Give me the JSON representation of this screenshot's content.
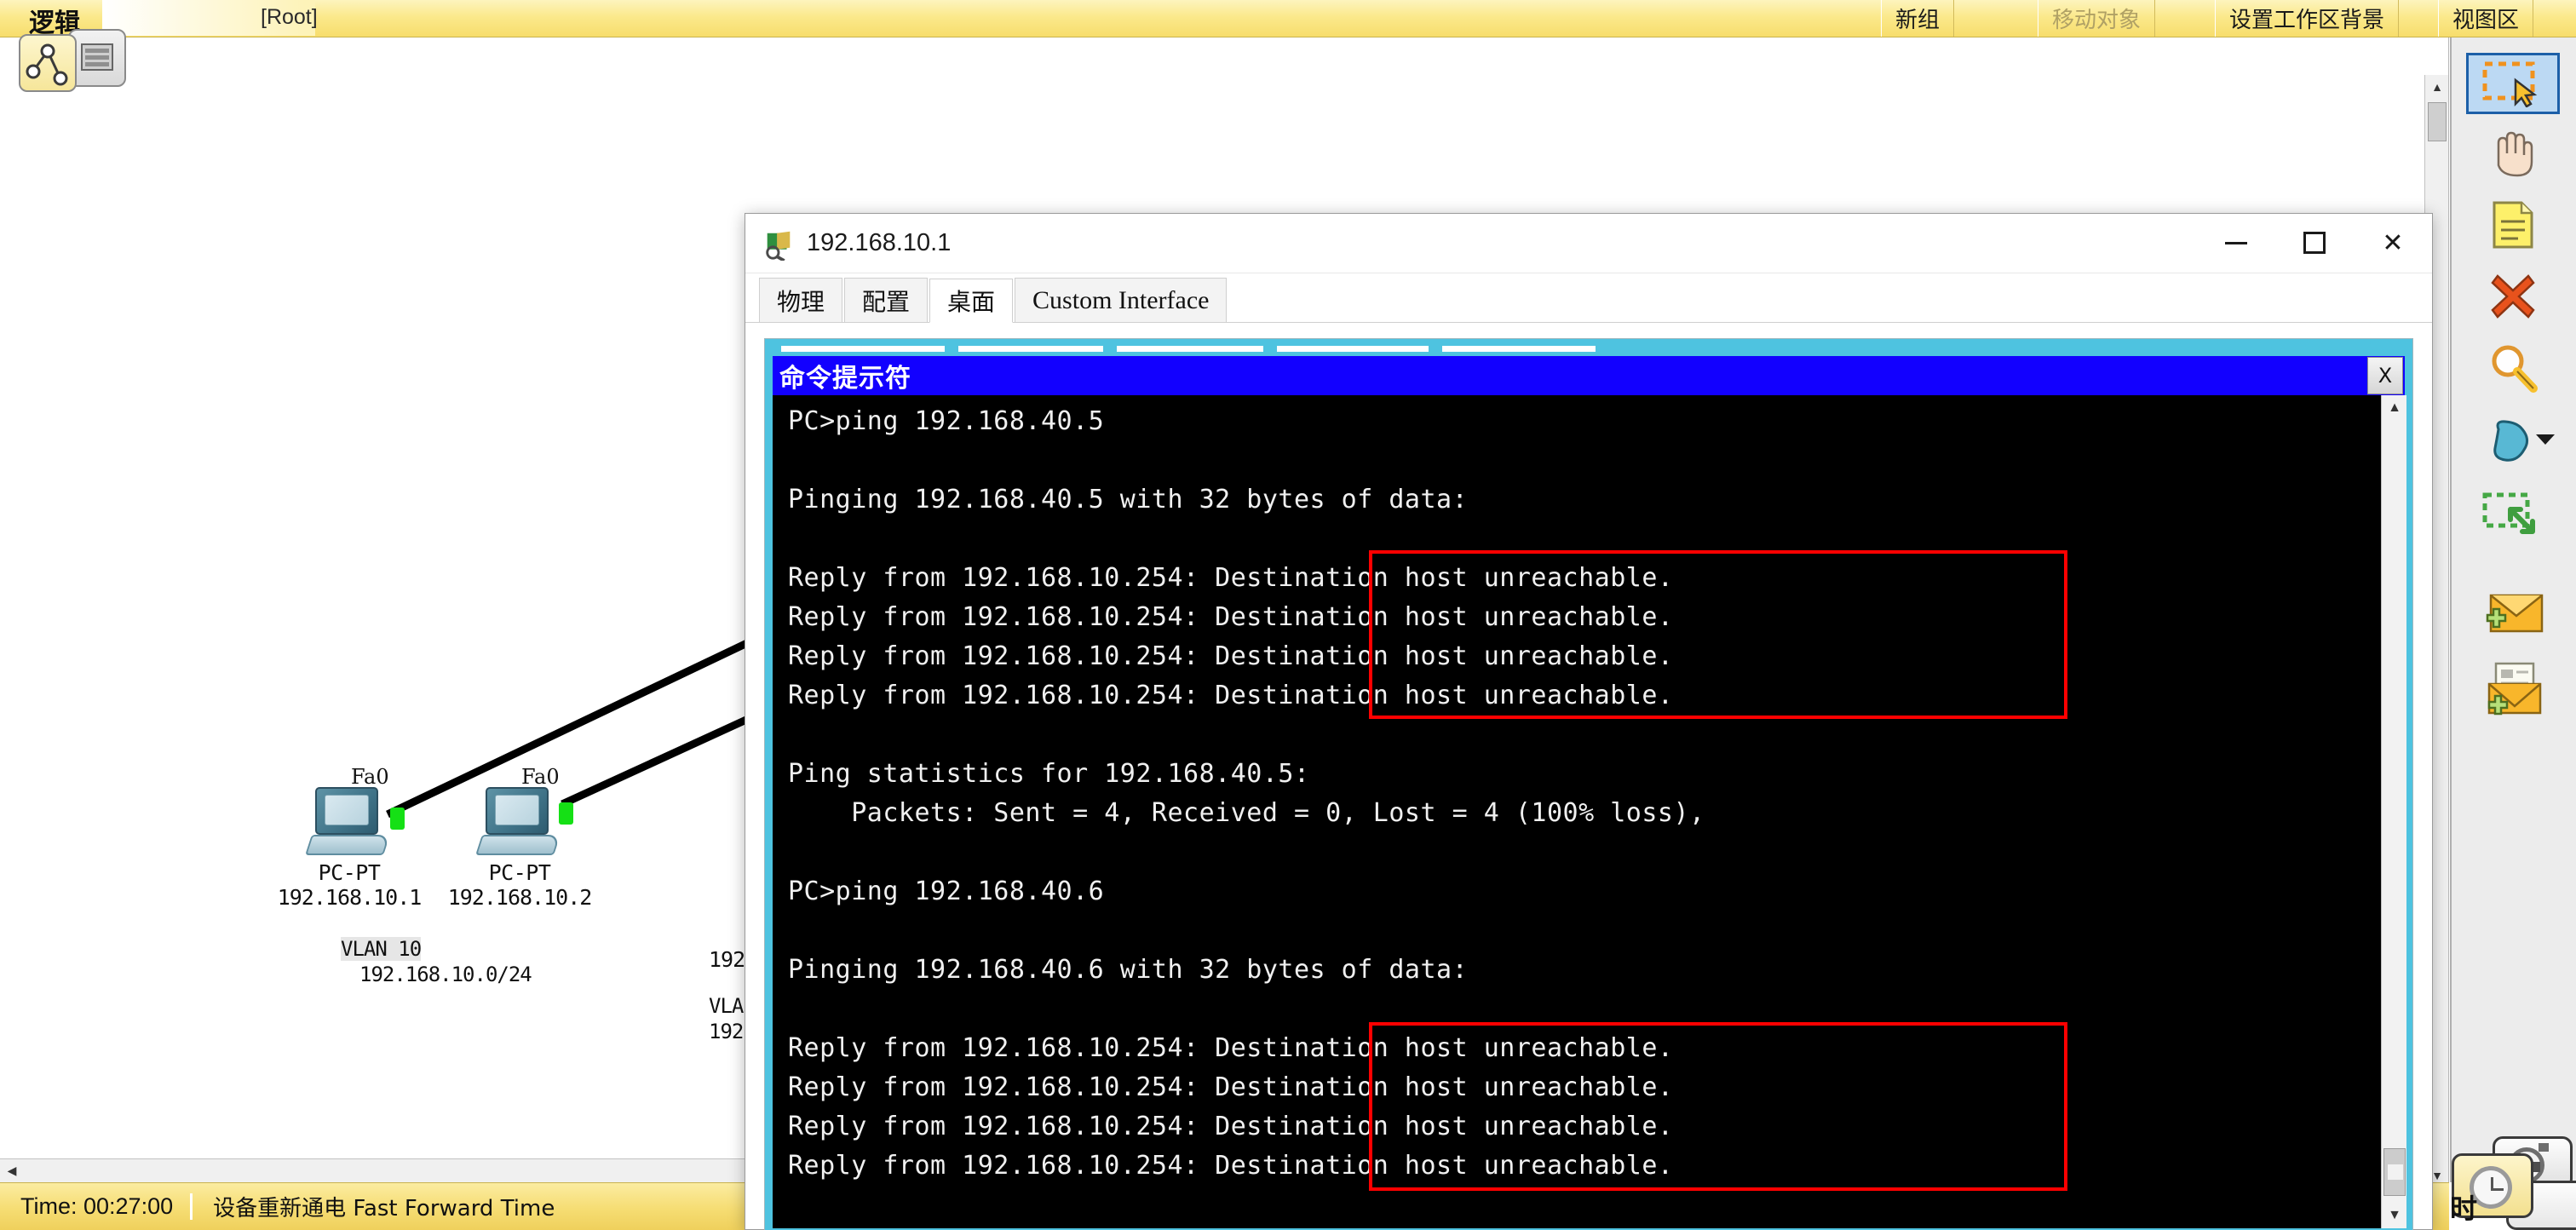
{
  "topbar": {
    "view_label": "逻辑",
    "root_label": "[Root]",
    "buttons": [
      {
        "label": "新组",
        "disabled": false
      },
      {
        "label": "移动对象",
        "disabled": true
      },
      {
        "label": "设置工作区背景",
        "disabled": false
      },
      {
        "label": "视图区",
        "disabled": false
      }
    ]
  },
  "workspace": {
    "devices": [
      {
        "name": "PC-PT",
        "ip": "192.168.10.1",
        "port": "Fa0"
      },
      {
        "name": "PC-PT",
        "ip": "192.168.10.2",
        "port": "Fa0"
      }
    ],
    "vlan_note": {
      "line1": "VLAN 10",
      "line2": "192.168.10.0/24"
    },
    "occluded_labels": {
      "ip_fragment": "192",
      "vlan_fragment": "VLA",
      "net_fragment": "192"
    }
  },
  "tools": [
    {
      "name": "select-tool",
      "label": "Select",
      "selected": true
    },
    {
      "name": "hand-tool",
      "label": "Move Layout",
      "selected": false
    },
    {
      "name": "note-tool",
      "label": "Place Note",
      "selected": false
    },
    {
      "name": "delete-tool",
      "label": "Delete",
      "selected": false
    },
    {
      "name": "inspect-tool",
      "label": "Inspect",
      "selected": false
    },
    {
      "name": "draw-shape-tool",
      "label": "Draw Shape",
      "selected": false
    },
    {
      "name": "resize-shape-tool",
      "label": "Resize Shape",
      "selected": false
    },
    {
      "name": "simple-pdu-tool",
      "label": "Add Simple PDU",
      "selected": false
    },
    {
      "name": "complex-pdu-tool",
      "label": "Add Complex PDU",
      "selected": false
    }
  ],
  "statusbar": {
    "time": "Time: 00:27:00",
    "message": "设备重新通电  Fast Forward Time"
  },
  "dialog": {
    "title": "192.168.10.1",
    "window_buttons": {
      "minimize": "–",
      "maximize": "□",
      "close": "✕"
    },
    "tabs": [
      {
        "label": "物理",
        "active": false,
        "latin": false
      },
      {
        "label": "配置",
        "active": false,
        "latin": false
      },
      {
        "label": "桌面",
        "active": true,
        "latin": false
      },
      {
        "label": "Custom Interface",
        "active": false,
        "latin": true
      }
    ],
    "command_prompt": {
      "window_title": "命令提示符",
      "close_label": "X",
      "lines": [
        "PC>ping 192.168.40.5",
        "",
        "Pinging 192.168.40.5 with 32 bytes of data:",
        "",
        "Reply from 192.168.10.254: Destination host unreachable.",
        "Reply from 192.168.10.254: Destination host unreachable.",
        "Reply from 192.168.10.254: Destination host unreachable.",
        "Reply from 192.168.10.254: Destination host unreachable.",
        "",
        "Ping statistics for 192.168.40.5:",
        "    Packets: Sent = 4, Received = 0, Lost = 4 (100% loss),",
        "",
        "PC>ping 192.168.40.6",
        "",
        "Pinging 192.168.40.6 with 32 bytes of data:",
        "",
        "Reply from 192.168.10.254: Destination host unreachable.",
        "Reply from 192.168.10.254: Destination host unreachable.",
        "Reply from 192.168.10.254: Destination host unreachable.",
        "Reply from 192.168.10.254: Destination host unreachable."
      ],
      "highlight_color": "#ff0000",
      "background_color": "#000000",
      "text_color": "#f0f0f0",
      "titlebar_color": "#1200ff"
    }
  }
}
